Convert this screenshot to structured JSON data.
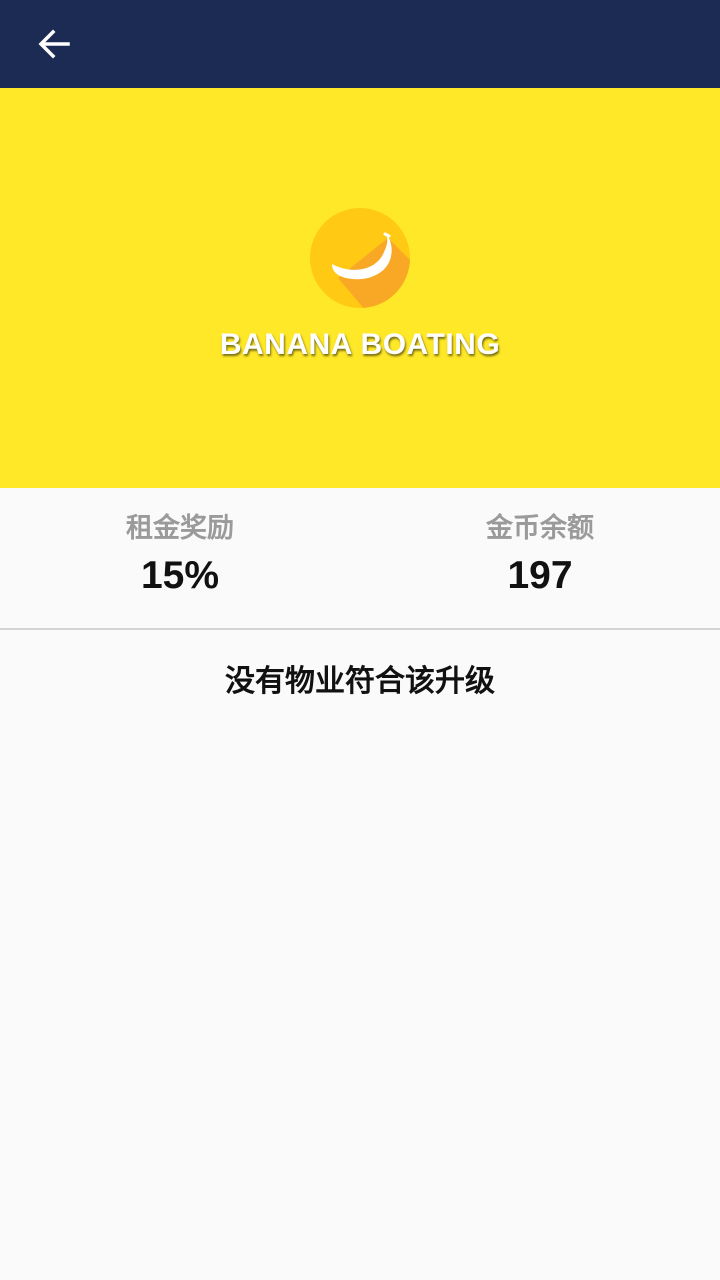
{
  "header": {
    "back_icon": "arrow-left-icon",
    "background_color": "#1c2b53"
  },
  "hero": {
    "title": "BANANA BOATING",
    "logo_icon": "banana-icon",
    "background_color": "#ffe827"
  },
  "stats": [
    {
      "label": "租金奖励",
      "value": "15%"
    },
    {
      "label": "金币余额",
      "value": "197"
    }
  ],
  "empty_message": "没有物业符合该升级"
}
